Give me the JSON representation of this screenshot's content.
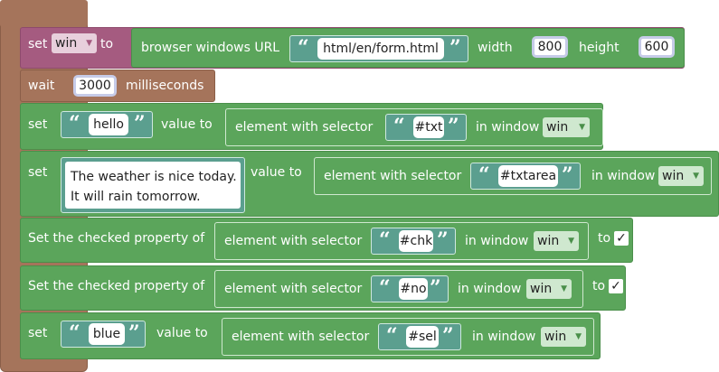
{
  "statements": {
    "label": "statements",
    "set_win": {
      "set": "set",
      "var": "win",
      "to": "to",
      "func": "browser windows URL",
      "url": "html/en/form.html",
      "width_label": "width",
      "width": "800",
      "height_label": "height",
      "height": "600"
    },
    "wait": {
      "label": "wait",
      "ms": "3000",
      "unit": "milliseconds"
    },
    "set_hello": {
      "set": "set",
      "value": "hello",
      "value_to": "value to",
      "element": "element with selector",
      "selector": "#txt",
      "in_window": "in window",
      "win": "win"
    },
    "set_textarea": {
      "set": "set",
      "line1": "The weather is nice today.",
      "line2": "It will rain tomorrow.",
      "value_to": "value to",
      "element": "element with selector",
      "selector": "#txtarea",
      "in_window": "in window",
      "win": "win"
    },
    "checked_chk": {
      "label": "Set the checked property of",
      "element": "element with selector",
      "selector": "#chk",
      "in_window": "in window",
      "win": "win",
      "to": "to",
      "check": "✓"
    },
    "checked_no": {
      "label": "Set the checked property of",
      "element": "element with selector",
      "selector": "#no",
      "in_window": "in window",
      "win": "win",
      "to": "to",
      "check": "✓"
    },
    "set_blue": {
      "set": "set",
      "value": "blue",
      "value_to": "value to",
      "element": "element with selector",
      "selector": "#sel",
      "in_window": "in window",
      "win": "win"
    }
  },
  "colors": {
    "statement_brown": "#a5745b",
    "block_green": "#5ba55b",
    "variable_purple": "#a55b80",
    "text_teal": "#5b9f8f"
  }
}
